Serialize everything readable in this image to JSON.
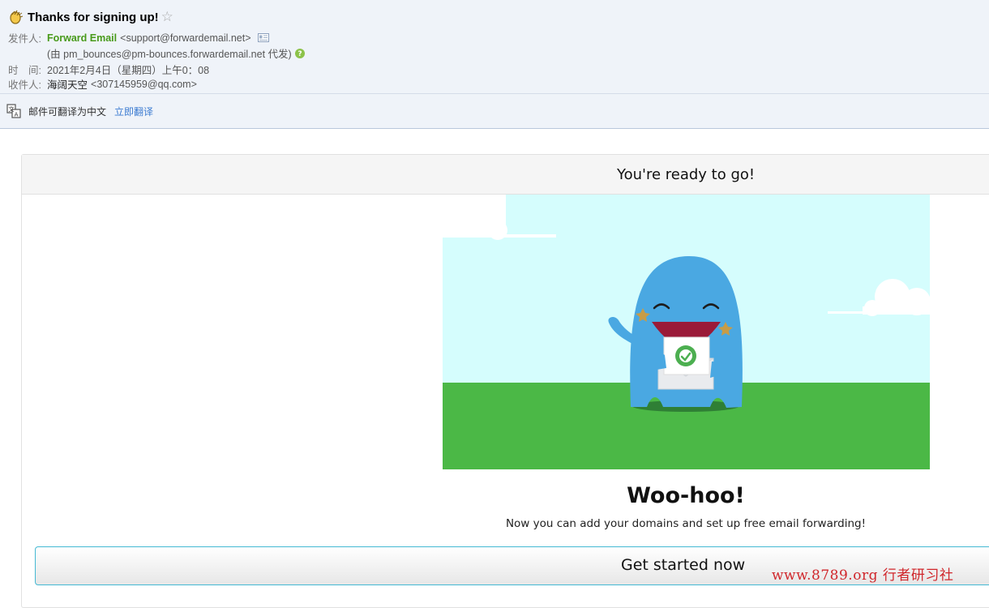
{
  "header": {
    "subject": "Thanks for signing up!",
    "sender_label": "发件人:",
    "sender_name": "Forward Email",
    "sender_email": "<support@forwardemail.net>",
    "on_behalf": "(由 pm_bounces@pm-bounces.forwardemail.net 代发)",
    "time_label": "时　间:",
    "time_value": "2021年2月4日（星期四）上午0：08",
    "recipient_label": "收件人:",
    "recipient_name": "海阔天空",
    "recipient_email": "<307145959@qq.com>"
  },
  "translate": {
    "text": "邮件可翻译为中文",
    "link": "立即翻译"
  },
  "email": {
    "header_title": "You're ready to go!",
    "title": "Woo-hoo!",
    "subtitle": "Now you can add your domains and set up free email forwarding!",
    "cta_label": "Get started now"
  },
  "watermark": "www.8789.org 行者研习社",
  "icons": {
    "subject": "clap-hands-icon",
    "star": "star-icon",
    "contact": "contact-card-icon",
    "help": "help-icon",
    "translate": "translate-icon"
  },
  "colors": {
    "sender": "#489a1a",
    "link": "#3b7bd1",
    "sky": "#d5fdfd",
    "grass": "#4bb846",
    "monster": "#4aa8e2",
    "cta_border": "#45b9d3",
    "watermark": "#d0262b"
  }
}
